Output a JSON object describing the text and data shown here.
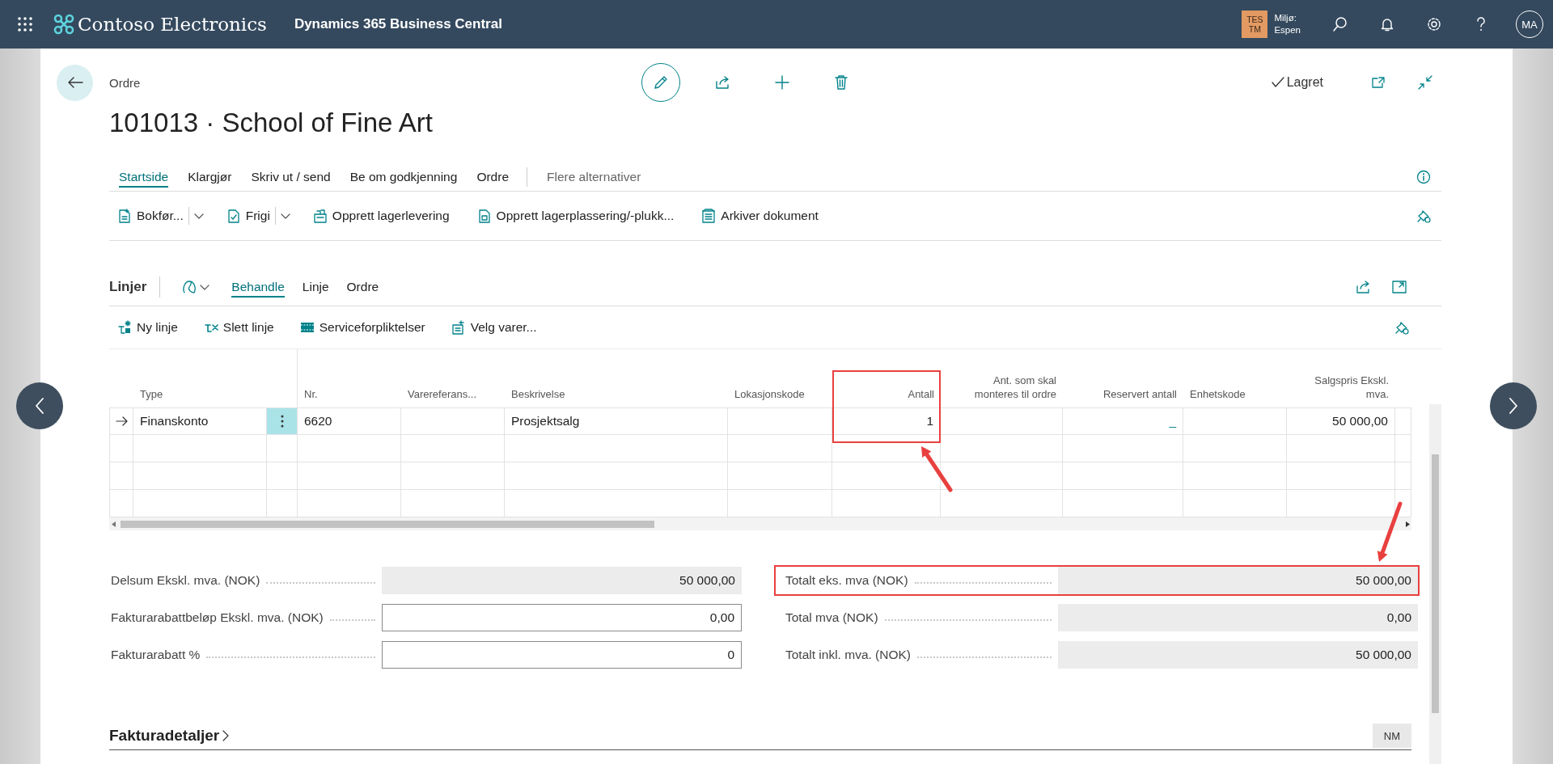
{
  "app_bar": {
    "brand": "Contoso Electronics",
    "product": "Dynamics 365 Business Central",
    "environment": {
      "badge": [
        "TES",
        "TM"
      ],
      "label": "Miljø:",
      "name": "Espen"
    },
    "avatar": "MA"
  },
  "page": {
    "caption": "Ordre",
    "title": "101013 · School of Fine Art",
    "save_status": "Lagret"
  },
  "tabs": [
    {
      "label": "Startside",
      "selected": true
    },
    {
      "label": "Klargjør",
      "selected": false
    },
    {
      "label": "Skriv ut / send",
      "selected": false
    },
    {
      "label": "Be om godkjenning",
      "selected": false
    },
    {
      "label": "Ordre",
      "selected": false
    }
  ],
  "more_tab": "Flere alternativer",
  "actions": [
    {
      "label": "Bokfør...",
      "kind": "split"
    },
    {
      "label": "Frigi",
      "kind": "split"
    },
    {
      "label": "Opprett lagerlevering",
      "kind": "plain"
    },
    {
      "label": "Opprett lagerplassering/-plukk...",
      "kind": "plain"
    },
    {
      "label": "Arkiver dokument",
      "kind": "plain"
    }
  ],
  "lines": {
    "title": "Linjer",
    "tabs": [
      {
        "label": "Behandle",
        "selected": true
      },
      {
        "label": "Linje",
        "selected": false
      },
      {
        "label": "Ordre",
        "selected": false
      }
    ],
    "actions": [
      {
        "label": "Ny linje"
      },
      {
        "label": "Slett linje"
      },
      {
        "label": "Serviceforpliktelser"
      },
      {
        "label": "Velg varer..."
      }
    ],
    "columns": [
      {
        "label": "Type",
        "kind": "text",
        "highlighted": false
      },
      {
        "label": "Nr.",
        "kind": "text",
        "highlighted": false
      },
      {
        "label": "Varereferans...",
        "kind": "text",
        "highlighted": false
      },
      {
        "label": "Beskrivelse",
        "kind": "text",
        "highlighted": false
      },
      {
        "label": "Lokasjonskode",
        "kind": "text",
        "highlighted": false
      },
      {
        "label": "Antall",
        "kind": "number",
        "highlighted": true
      },
      {
        "label": "Ant. som skal monteres til ordre",
        "kind": "number",
        "highlighted": false
      },
      {
        "label": "Reservert antall",
        "kind": "drilldown",
        "highlighted": false
      },
      {
        "label": "Enhetskode",
        "kind": "text",
        "highlighted": false
      },
      {
        "label": "Salgspris Ekskl. mva.",
        "kind": "number",
        "highlighted": false
      }
    ],
    "rows": [
      {
        "current": true,
        "cells": [
          "Finanskonto",
          "6620",
          null,
          "Prosjektsalg",
          null,
          "1",
          null,
          "_",
          null,
          "50 000,00"
        ]
      }
    ]
  },
  "totals": {
    "left": [
      {
        "label": "Delsum Ekskl. mva. (NOK)",
        "value": "50 000,00",
        "kind": "readonly",
        "highlighted": false
      },
      {
        "label": "Fakturarabattbeløp Ekskl. mva. (NOK)",
        "value": "0,00",
        "kind": "input",
        "highlighted": false
      },
      {
        "label": "Fakturarabatt %",
        "value": "0",
        "kind": "input",
        "highlighted": false
      }
    ],
    "right": [
      {
        "label": "Totalt eks. mva (NOK)",
        "value": "50 000,00",
        "kind": "readonly",
        "highlighted": true
      },
      {
        "label": "Total mva (NOK)",
        "value": "0,00",
        "kind": "readonly",
        "highlighted": false
      },
      {
        "label": "Totalt inkl. mva. (NOK)",
        "value": "50 000,00",
        "kind": "readonly",
        "highlighted": false
      }
    ]
  },
  "section": {
    "title": "Fakturadetaljer",
    "badge": "NM"
  }
}
